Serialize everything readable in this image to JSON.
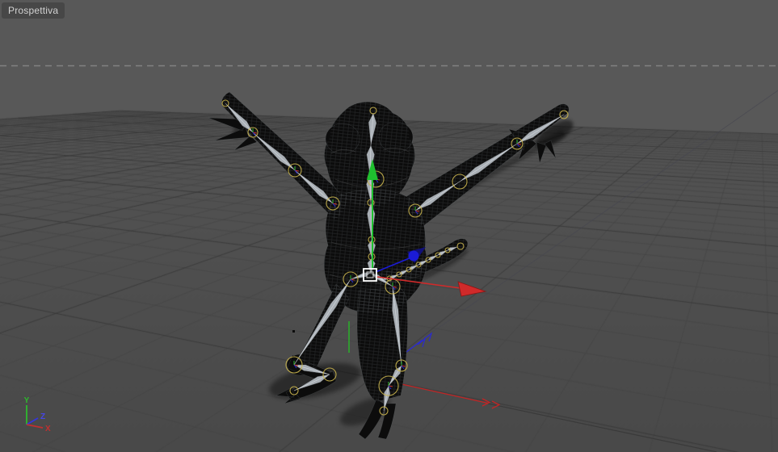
{
  "viewport": {
    "label": "Prospettiva"
  },
  "axis_gizmo": {
    "x_label": "X",
    "y_label": "Y",
    "z_label": "Z"
  },
  "colors": {
    "background": "#585858",
    "ground_top": "#555555",
    "ground_bottom": "#494949",
    "grid_line": "#454545",
    "grid_major": "#383838",
    "horizon": "#919191",
    "axis_x": "#c83232",
    "axis_y": "#2db92d",
    "axis_z": "#2a2ad2",
    "manipulator_x": "#d02a2a",
    "manipulator_y": "#1fc02f",
    "manipulator_z": "#1b1bd6",
    "selection_cube": "#ffffff",
    "joint_ring": "#c9b44c",
    "bone": "#c3cad1",
    "mesh": "#0c0c0c",
    "label_bg": "#474747",
    "label_text": "#d2d2d2"
  }
}
